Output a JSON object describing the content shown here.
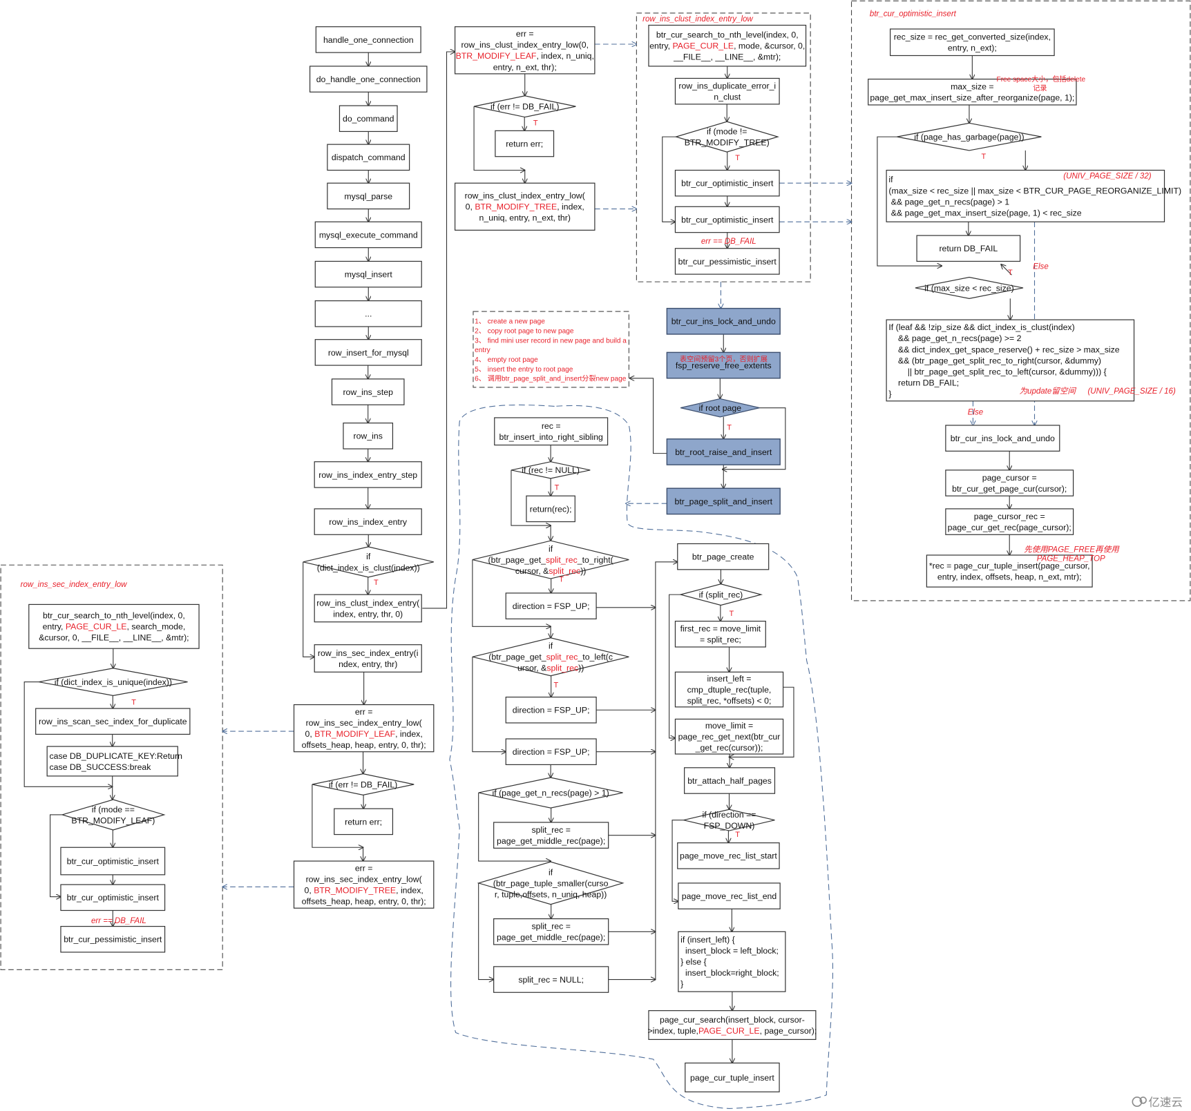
{
  "groups": {
    "sec-low-frame": "row_ins_sec_index_entry_low",
    "clust-low-frame": "row_ins_clust_index_entry_low",
    "optimistic-frame": "btr_cur_optimistic_insert"
  },
  "nodes": {
    "handle-one-connection": {
      "lines": [
        "handle_one_connection"
      ]
    },
    "do-handle-one-connection": {
      "lines": [
        "do_handle_one_connection"
      ]
    },
    "do-command": {
      "lines": [
        "do_command"
      ]
    },
    "dispatch-command": {
      "lines": [
        "dispatch_command"
      ]
    },
    "mysql-parse": {
      "lines": [
        "mysql_parse"
      ]
    },
    "mysql-execute-command": {
      "lines": [
        "mysql_execute_command"
      ]
    },
    "mysql-insert": {
      "lines": [
        "mysql_insert"
      ]
    },
    "ellipsis": {
      "lines": [
        "..."
      ]
    },
    "row-insert-for-mysql": {
      "lines": [
        "row_insert_for_mysql"
      ]
    },
    "row-ins-step": {
      "lines": [
        "row_ins_step"
      ]
    },
    "row-ins": {
      "lines": [
        "row_ins"
      ]
    },
    "row-ins-index-entry-step": {
      "lines": [
        "row_ins_index_entry_step"
      ]
    },
    "row-ins-index-entry": {
      "lines": [
        "row_ins_index_entry"
      ]
    },
    "if-dict-index-is-clust": {
      "lines": [
        "if",
        "(dict_index_is_clust(index))"
      ]
    },
    "row-ins-clust-index-entry": {
      "lines": [
        "row_ins_clust_index_entry(",
        "index, entry, thr, 0)"
      ]
    },
    "row-ins-sec-index-entry": {
      "lines": [
        "row_ins_sec_index_entry(i",
        "ndex, entry, thr)"
      ]
    },
    "sec-entry-low-leaf": {
      "lines": [
        "err =",
        "row_ins_sec_index_entry_low(",
        "0, BTR_MODIFY_LEAF, index,",
        "offsets_heap, heap, entry, 0, thr);"
      ],
      "red": "BTR_MODIFY_LEAF"
    },
    "if-sec-err-not-fail": {
      "lines": [
        "if (err != DB_FAIL)"
      ]
    },
    "sec-return-err": {
      "lines": [
        "return err;"
      ]
    },
    "sec-entry-low-tree": {
      "lines": [
        "err =",
        "row_ins_sec_index_entry_low(",
        "0, BTR_MODIFY_TREE, index,",
        "offsets_heap, heap, entry, 0, thr);"
      ],
      "red": "BTR_MODIFY_TREE"
    },
    "sec-search": {
      "lines": [
        "btr_cur_search_to_nth_level(index, 0,",
        "entry, PAGE_CUR_LE, search_mode,",
        "&cursor, 0, __FILE__, __LINE__, &mtr);"
      ],
      "red": "PAGE_CUR_LE"
    },
    "if-unique": {
      "lines": [
        "if (dict_index_is_unique(index))"
      ]
    },
    "scan-duplicate": {
      "lines": [
        "row_ins_scan_sec_index_for_duplicate"
      ]
    },
    "dup-case": {
      "lines": [
        "case DB_DUPLICATE_KEY:Return",
        "case DB_SUCCESS:break"
      ]
    },
    "if-mode-leaf": {
      "lines": [
        "if (mode ==",
        "BTR_MODIFY_LEAF)"
      ]
    },
    "sec-optimistic-1": {
      "lines": [
        "btr_cur_optimistic_insert"
      ]
    },
    "sec-optimistic-2": {
      "lines": [
        "btr_cur_optimistic_insert"
      ]
    },
    "sec-pessimistic": {
      "lines": [
        "btr_cur_pessimistic_insert"
      ]
    },
    "clust-entry-low-leaf": {
      "lines": [
        "err =",
        "row_ins_clust_index_entry_low(0,",
        "BTR_MODIFY_LEAF, index, n_uniq,",
        "entry, n_ext, thr);"
      ],
      "red": "BTR_MODIFY_LEAF"
    },
    "if-clust-err-not-fail": {
      "lines": [
        "if (err != DB_FAIL)"
      ]
    },
    "clust-return-err": {
      "lines": [
        "return err;"
      ]
    },
    "clust-entry-low-tree": {
      "lines": [
        "row_ins_clust_index_entry_low(",
        "0, BTR_MODIFY_TREE, index,",
        "n_uniq, entry, n_ext, thr)"
      ],
      "red": "BTR_MODIFY_TREE"
    },
    "clust-search": {
      "lines": [
        "btr_cur_search_to_nth_level(index, 0,",
        "entry, PAGE_CUR_LE, mode, &cursor, 0,",
        "__FILE__, __LINE__, &mtr);"
      ],
      "red": "PAGE_CUR_LE"
    },
    "dup-error-clust": {
      "lines": [
        "row_ins_duplicate_error_i",
        "n_clust"
      ]
    },
    "if-mode-not-tree": {
      "lines": [
        "if (mode !=",
        "BTR_MODIFY_TREE)"
      ]
    },
    "clust-optimistic-1": {
      "lines": [
        "btr_cur_optimistic_insert"
      ]
    },
    "clust-optimistic-2": {
      "lines": [
        "btr_cur_optimistic_insert"
      ]
    },
    "clust-pessimistic": {
      "lines": [
        "btr_cur_pessimistic_insert"
      ]
    },
    "ins-lock-undo": {
      "lines": [
        "btr_cur_ins_lock_and_undo"
      ]
    },
    "fsp-reserve": {
      "lines": [
        "fsp_reserve_free_extents"
      ]
    },
    "if-root-page": {
      "lines": [
        "if root page"
      ]
    },
    "root-raise": {
      "lines": [
        "btr_root_raise_and_insert"
      ]
    },
    "page-split": {
      "lines": [
        "btr_page_split_and_insert"
      ]
    },
    "insert-right-sibling": {
      "lines": [
        "rec =",
        "btr_insert_into_right_sibling"
      ]
    },
    "if-rec-not-null": {
      "lines": [
        "if (rec != NULL)"
      ]
    },
    "return-rec": {
      "lines": [
        "return(rec);"
      ]
    },
    "if-split-right": {
      "lines": [
        "if",
        "(btr_page_get_split_rec_to_right(",
        "cursor, &split_rec))"
      ],
      "red": "split_rec"
    },
    "dir-up-1": {
      "lines": [
        "direction = FSP_UP;"
      ]
    },
    "if-split-left": {
      "lines": [
        "if",
        "(btr_page_get_split_rec_to_left(c",
        "ursor, &split_rec))"
      ],
      "red": "split_rec"
    },
    "dir-up-2": {
      "lines": [
        "direction = FSP_UP;"
      ]
    },
    "dir-up-3": {
      "lines": [
        "direction = FSP_UP;"
      ]
    },
    "if-n-recs": {
      "lines": [
        "if (page_get_n_recs(page) > 1)"
      ]
    },
    "middle-rec-1": {
      "lines": [
        "split_rec =",
        "page_get_middle_rec(page);"
      ]
    },
    "if-tuple-smaller": {
      "lines": [
        "if",
        "(btr_page_tuple_smaller(curso",
        "r, tuple,offsets, n_uniq, heap))"
      ]
    },
    "middle-rec-2": {
      "lines": [
        "split_rec =",
        "page_get_middle_rec(page);"
      ]
    },
    "split-rec-null": {
      "lines": [
        "split_rec = NULL;"
      ]
    },
    "page-create": {
      "lines": [
        "btr_page_create"
      ]
    },
    "if-split-rec": {
      "lines": [
        "if (split_rec)"
      ]
    },
    "first-rec": {
      "lines": [
        "first_rec = move_limit",
        "= split_rec;"
      ]
    },
    "insert-left": {
      "lines": [
        "insert_left =",
        "cmp_dtuple_rec(tuple,",
        "split_rec, *offsets) < 0;"
      ]
    },
    "move-limit": {
      "lines": [
        "move_limit =",
        "page_rec_get_next(btr_cur",
        "_get_rec(cursor));"
      ]
    },
    "attach-half": {
      "lines": [
        "btr_attach_half_pages"
      ]
    },
    "if-direction-down": {
      "lines": [
        "if (direction ==",
        "FSP_DOWN)"
      ]
    },
    "move-list-start": {
      "lines": [
        "page_move_rec_list_start"
      ]
    },
    "move-list-end": {
      "lines": [
        "page_move_rec_list_end"
      ]
    },
    "insert-block": {
      "lines": [
        "if (insert_left) {",
        "  insert_block = left_block;",
        "} else {",
        "  insert_block=right_block;",
        "}"
      ]
    },
    "page-cur-search": {
      "lines": [
        "page_cur_search(insert_block, cursor-",
        ">index, tuple,PAGE_CUR_LE, page_cursor);"
      ],
      "red": "PAGE_CUR_LE"
    },
    "page-cur-tuple-insert": {
      "lines": [
        "page_cur_tuple_insert"
      ]
    },
    "opt-rec-size": {
      "lines": [
        "rec_size = rec_get_converted_size(index,",
        "entry, n_ext);"
      ]
    },
    "opt-max-size": {
      "lines": [
        "max_size =",
        "page_get_max_insert_size_after_reorganize(page, 1);"
      ]
    },
    "if-has-garbage": {
      "lines": [
        "if (page_has_garbage(page))"
      ]
    },
    "opt-reorg-check": {
      "lines": [
        "if",
        "(max_size < rec_size || max_size < BTR_CUR_PAGE_REORGANIZE_LIMIT)",
        " && page_get_n_recs(page) > 1",
        " && page_get_max_insert_size(page, 1) < rec_size"
      ]
    },
    "opt-return-fail": {
      "lines": [
        "return DB_FAIL"
      ]
    },
    "if-max-lt-rec": {
      "lines": [
        "if (max_size < rec_size)"
      ]
    },
    "opt-leaf-check": {
      "lines": [
        "If (leaf && !zip_size && dict_index_is_clust(index)",
        "    && page_get_n_recs(page) >= 2",
        "    && dict_index_get_space_reserve() + rec_size > max_size",
        "    && (btr_page_get_split_rec_to_right(cursor, &dummy)",
        "        || btr_page_get_split_rec_to_left(cursor, &dummy))) {",
        "    return DB_FAIL;",
        "}"
      ]
    },
    "opt-lock-undo": {
      "lines": [
        "btr_cur_ins_lock_and_undo"
      ]
    },
    "opt-page-cursor": {
      "lines": [
        "page_cursor =",
        "btr_cur_get_page_cur(cursor);"
      ]
    },
    "opt-cursor-rec": {
      "lines": [
        "page_cursor_rec =",
        "page_cur_get_rec(page_cursor);"
      ]
    },
    "opt-tuple-insert": {
      "lines": [
        "*rec = page_cur_tuple_insert(page_cursor,",
        "entry, index, offsets, heap, n_ext, mtr);"
      ]
    }
  },
  "annotations": {
    "sec-fail-label": "err == DB_FAIL",
    "clust-fail-label": "err == DB_FAIL",
    "fsp-note": "表空间预留3个页，否则扩展",
    "free-space-note": "Free space大小，包括delete",
    "free-space-note-2": "记录",
    "page-size-32": "(UNIV_PAGE_SIZE / 32)",
    "page-size-16": "(UNIV_PAGE_SIZE / 16)",
    "update-reserve-note": "为update留空间",
    "else-label-1": "Else",
    "else-label-2": "Else",
    "heap-note-1": "先使用PAGE_FREE再使用",
    "heap-note-2": "PAGE_HEAP_TOP"
  },
  "root_raise_steps": [
    "1、 create a new page",
    "2、 copy root page to new page",
    "3、 find mini user record in new page and build a",
    "entry",
    "4、 empty root page",
    "5、 insert the entry to root page",
    "6、 调用btr_page_split_and_insert分裂new page"
  ],
  "true_label": "T",
  "watermark": "亿速云",
  "colors": {
    "highlight_box": "#8ea6cb",
    "annotation": "#e8202a",
    "dashed_link": "#4f6e9a"
  }
}
